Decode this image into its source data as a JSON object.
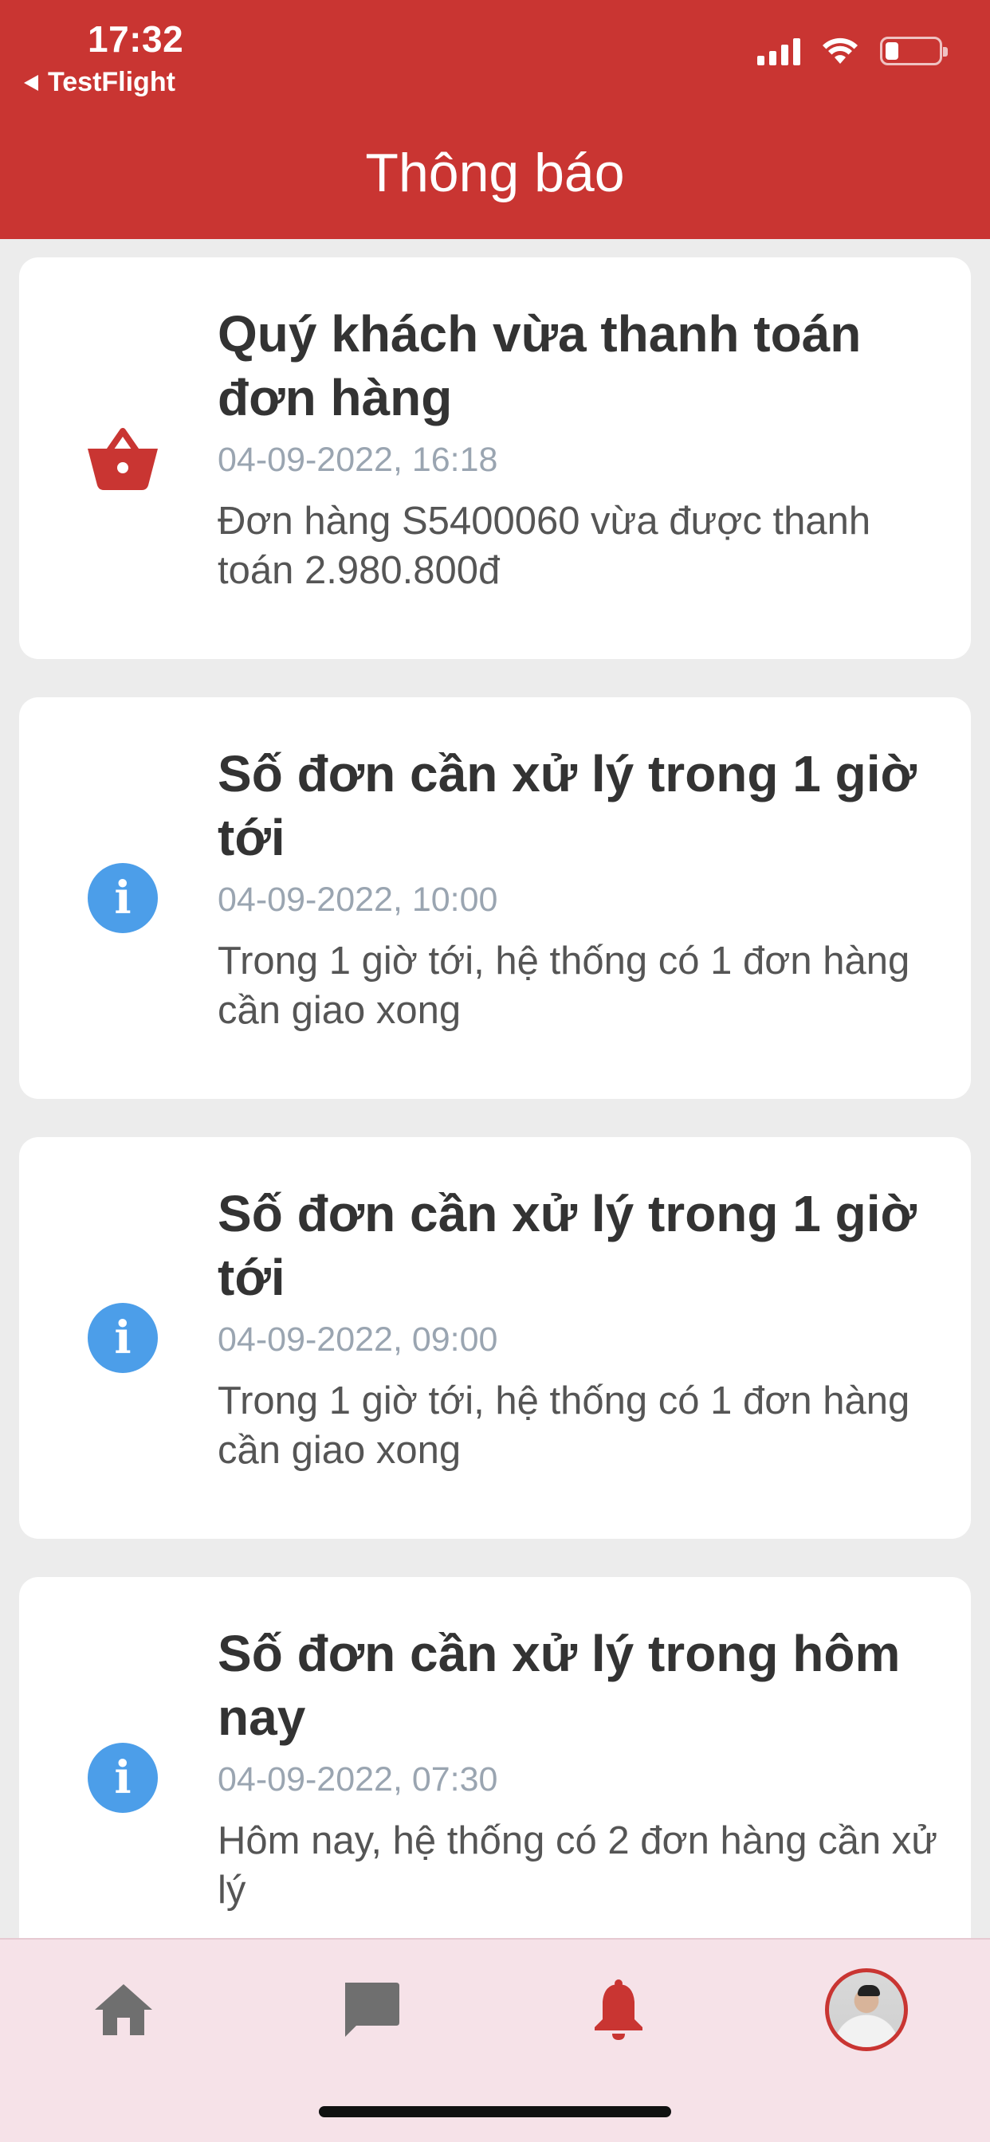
{
  "status_bar": {
    "time": "17:32",
    "back_app": "TestFlight"
  },
  "header": {
    "title": "Thông báo"
  },
  "notifications": [
    {
      "icon": "basket-icon",
      "title": "Quý khách vừa thanh toán đơn hàng",
      "time": "04-09-2022, 16:18",
      "description": "Đơn hàng S5400060 vừa được thanh toán 2.980.800đ"
    },
    {
      "icon": "info-icon",
      "title": "Số đơn cần xử lý trong 1 giờ tới",
      "time": "04-09-2022, 10:00",
      "description": "Trong 1 giờ tới, hệ thống có 1 đơn hàng cần giao xong"
    },
    {
      "icon": "info-icon",
      "title": "Số đơn cần xử lý trong 1 giờ tới",
      "time": "04-09-2022, 09:00",
      "description": "Trong 1 giờ tới, hệ thống có 1 đơn hàng cần giao xong"
    },
    {
      "icon": "info-icon",
      "title": "Số đơn cần xử lý trong hôm nay",
      "time": "04-09-2022, 07:30",
      "description": "Hôm nay, hệ thống có 2 đơn hàng cần xử lý"
    }
  ],
  "bottom_nav": {
    "items": [
      "home-icon",
      "chat-icon",
      "bell-icon",
      "avatar"
    ],
    "active": "bell-icon"
  },
  "colors": {
    "brand_red": "#c93532",
    "info_blue": "#4c9ee9",
    "nav_inactive": "#6f6f6f",
    "nav_background": "#f6e2e8"
  }
}
